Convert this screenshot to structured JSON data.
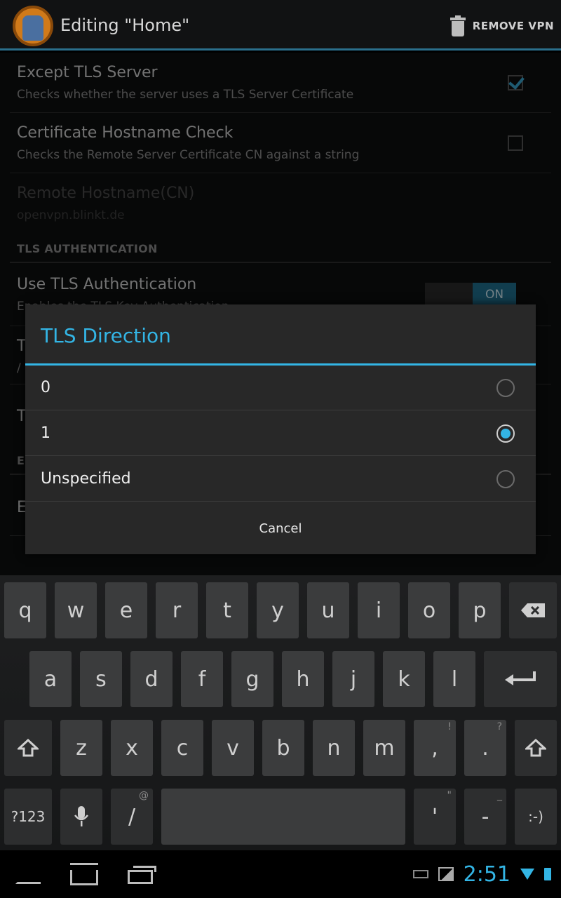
{
  "action_bar": {
    "title": "Editing \"Home\"",
    "remove_label": "REMOVE VPN"
  },
  "prefs": {
    "except_tls": {
      "title": "Except TLS Server",
      "summary": "Checks whether the server uses a TLS Server Certificate",
      "checked": true
    },
    "hostname_check": {
      "title": "Certificate Hostname Check",
      "summary": "Checks the Remote Server Certificate CN against a string",
      "checked": false
    },
    "remote_hostname": {
      "title": "Remote Hostname(CN)",
      "summary": "openvpn.blinkt.de"
    },
    "tls_auth_section": "TLS AUTHENTICATION",
    "use_tls_auth": {
      "title": "Use TLS Authentication",
      "summary": "Enables the TLS Key Authentication",
      "toggle": "ON"
    },
    "partial_rows": [
      "T",
      "/",
      "T",
      "E",
      "E"
    ]
  },
  "dialog": {
    "title": "TLS Direction",
    "options": [
      {
        "label": "0",
        "selected": false
      },
      {
        "label": "1",
        "selected": true
      },
      {
        "label": "Unspecified",
        "selected": false
      }
    ],
    "cancel": "Cancel"
  },
  "keyboard": {
    "row1": [
      "q",
      "w",
      "e",
      "r",
      "t",
      "y",
      "u",
      "i",
      "o",
      "p"
    ],
    "row2": [
      "a",
      "s",
      "d",
      "f",
      "g",
      "h",
      "j",
      "k",
      "l"
    ],
    "row3": [
      "z",
      "x",
      "c",
      "v",
      "b",
      "n",
      "m",
      ",",
      "."
    ],
    "row3_hints": [
      "!",
      "?"
    ],
    "row4": {
      "symbols": "?123",
      "slash": "/",
      "slash_hint": "@",
      "quote": "'",
      "quote_hint": "\"",
      "dash": "-",
      "dash_hint": "_",
      "smiley": ":-)"
    }
  },
  "status": {
    "time": "2:51"
  },
  "colors": {
    "accent": "#33b5e5",
    "background": "#000000",
    "dialog": "#282828"
  }
}
